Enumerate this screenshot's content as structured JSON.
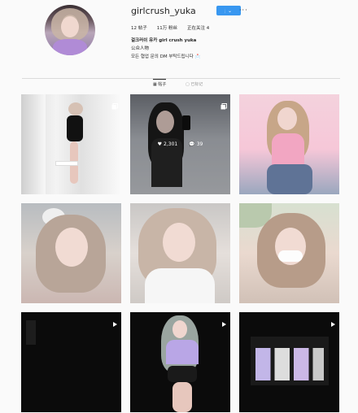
{
  "profile": {
    "username": "girlcrush_yuka",
    "follow_label": "关注",
    "dropdown_icon": "chevron-down-icon",
    "more_label": "···",
    "stats": {
      "posts": "12 帖子",
      "followers": "11万 粉丝",
      "following": "正在关注 4"
    },
    "bio": {
      "title": "걸크러쉬 유카 girl crush yuka",
      "category": "公众人物",
      "line": "모든 협업 문의 DM 부탁드립니다 📩"
    }
  },
  "tabs": [
    {
      "label": "▦ 帖子",
      "active": true
    },
    {
      "label": "▢ 已标记",
      "active": false
    }
  ],
  "posts": [
    {
      "badge": "multi-icon"
    },
    {
      "badge": "multi-icon",
      "likes": "2,301",
      "comments": "39"
    },
    {
      "badge": ""
    },
    {
      "badge": ""
    },
    {
      "badge": ""
    },
    {
      "badge": ""
    },
    {
      "badge": "video-icon"
    },
    {
      "badge": "video-icon"
    },
    {
      "badge": "video-icon"
    }
  ]
}
